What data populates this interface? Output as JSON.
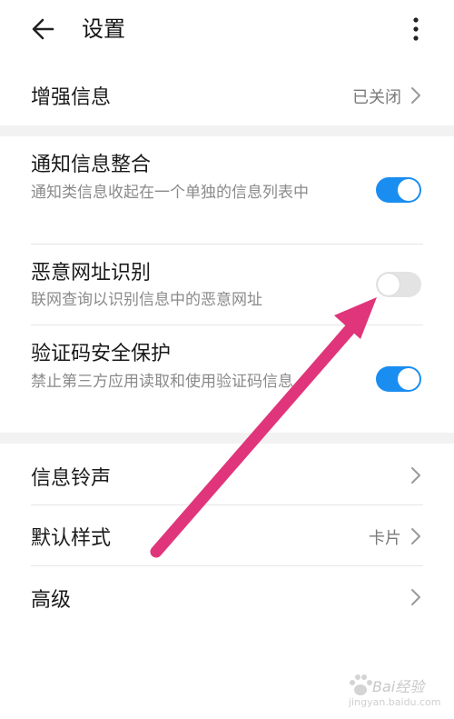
{
  "header": {
    "title": "设置",
    "back_icon": "arrow-left-icon",
    "more_icon": "more-vertical-icon"
  },
  "items": {
    "enhanced_info": {
      "label": "增强信息",
      "value": "已关闭"
    },
    "notification_merge": {
      "label": "通知信息整合",
      "desc": "通知类信息收起在一个单独的信息列表中",
      "enabled": true
    },
    "malicious_url": {
      "label": "恶意网址识别",
      "desc": "联网查询以识别信息中的恶意网址",
      "enabled": false
    },
    "verification_code": {
      "label": "验证码安全保护",
      "desc": "禁止第三方应用读取和使用验证码信息",
      "enabled": true
    },
    "ringtone": {
      "label": "信息铃声"
    },
    "default_style": {
      "label": "默认样式",
      "value": "卡片"
    },
    "advanced": {
      "label": "高级"
    }
  },
  "colors": {
    "toggle_on": "#1a8df0",
    "toggle_off": "#e3e3e3",
    "annotation_arrow": "#e0357a"
  },
  "watermark": {
    "text": "Bai经验",
    "site": "jingyan.baidu.com"
  }
}
